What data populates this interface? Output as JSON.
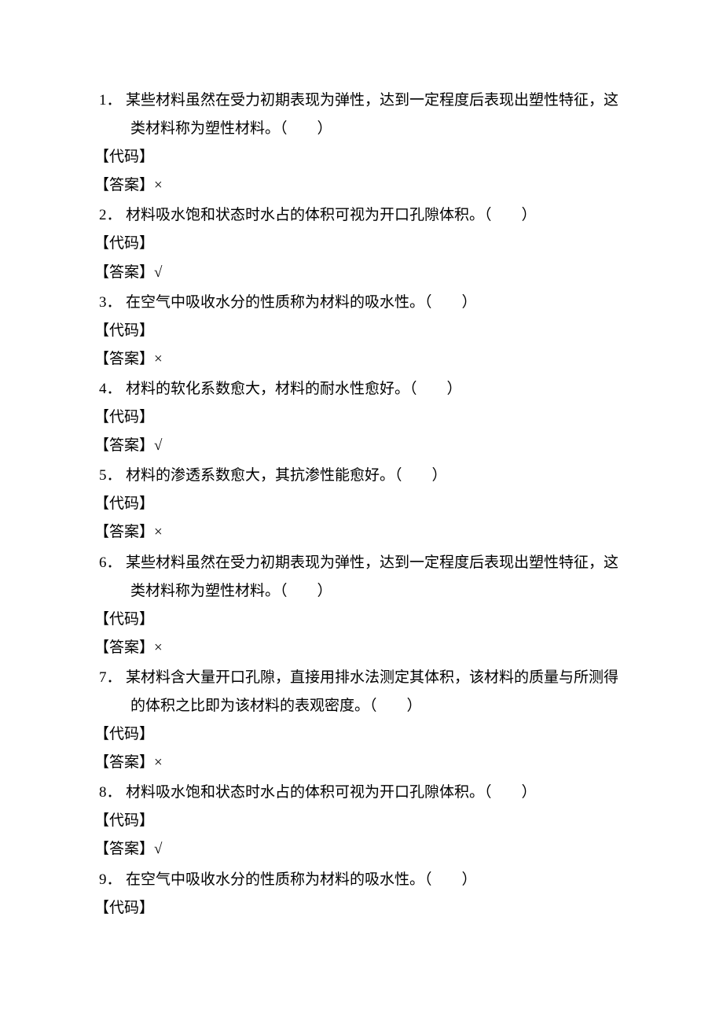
{
  "labels": {
    "code": "【代码】",
    "answer_prefix": "【答案】"
  },
  "questions": [
    {
      "number": "1．",
      "text_line1": "某些材料虽然在受力初期表现为弹性，达到一定程度后表现出塑性特征，这",
      "text_line2": "类材料称为塑性材料。（　　）",
      "answer": "×"
    },
    {
      "number": "2．",
      "text_line1": "材料吸水饱和状态时水占的体积可视为开口孔隙体积。（　　）",
      "text_line2": "",
      "answer": "√"
    },
    {
      "number": "3．",
      "text_line1": "在空气中吸收水分的性质称为材料的吸水性。（　　）",
      "text_line2": "",
      "answer": "×"
    },
    {
      "number": "4．",
      "text_line1": "材料的软化系数愈大，材料的耐水性愈好。（　　）",
      "text_line2": "",
      "answer": "√"
    },
    {
      "number": "5．",
      "text_line1": "材料的渗透系数愈大，其抗渗性能愈好。（　　）",
      "text_line2": "",
      "answer": "×"
    },
    {
      "number": "6．",
      "text_line1": "某些材料虽然在受力初期表现为弹性，达到一定程度后表现出塑性特征，这",
      "text_line2": "类材料称为塑性材料。（　　）",
      "answer": "×"
    },
    {
      "number": "7．",
      "text_line1": "某材料含大量开口孔隙，直接用排水法测定其体积，该材料的质量与所测得",
      "text_line2": "的体积之比即为该材料的表观密度。（　　）",
      "answer": "×"
    },
    {
      "number": "8．",
      "text_line1": "材料吸水饱和状态时水占的体积可视为开口孔隙体积。（　　）",
      "text_line2": "",
      "answer": "√"
    },
    {
      "number": "9．",
      "text_line1": "在空气中吸收水分的性质称为材料的吸水性。（　　）",
      "text_line2": "",
      "answer": ""
    }
  ]
}
